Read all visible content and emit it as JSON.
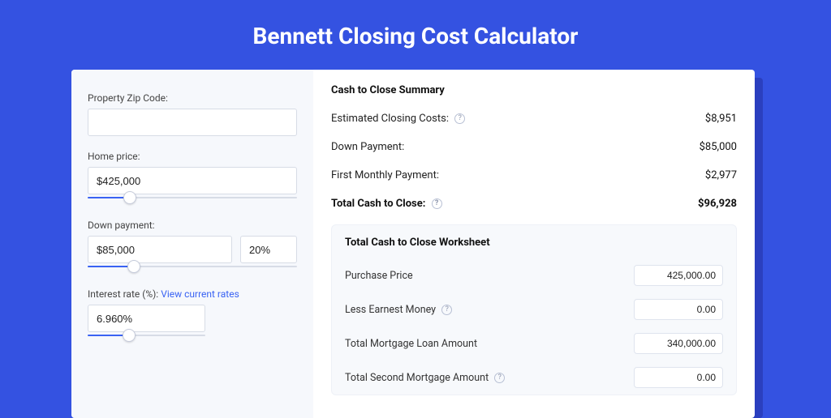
{
  "title": "Bennett Closing Cost Calculator",
  "left": {
    "zip_label": "Property Zip Code:",
    "zip_value": "",
    "home_price_label": "Home price:",
    "home_price_value": "$425,000",
    "home_price_slider_pct": 20,
    "down_payment_label": "Down payment:",
    "down_payment_value": "$85,000",
    "down_payment_pct": "20%",
    "down_payment_slider_pct": 22,
    "interest_label": "Interest rate (%):",
    "interest_link": "View current rates",
    "interest_value": "6.960%",
    "interest_slider_pct": 35
  },
  "summary": {
    "heading": "Cash to Close Summary",
    "rows": [
      {
        "label": "Estimated Closing Costs:",
        "help": true,
        "value": "$8,951"
      },
      {
        "label": "Down Payment:",
        "help": false,
        "value": "$85,000"
      },
      {
        "label": "First Monthly Payment:",
        "help": false,
        "value": "$2,977"
      }
    ],
    "total_label": "Total Cash to Close:",
    "total_help": true,
    "total_value": "$96,928"
  },
  "worksheet": {
    "heading": "Total Cash to Close Worksheet",
    "rows": [
      {
        "label": "Purchase Price",
        "help": false,
        "value": "425,000.00"
      },
      {
        "label": "Less Earnest Money",
        "help": true,
        "value": "0.00"
      },
      {
        "label": "Total Mortgage Loan Amount",
        "help": false,
        "value": "340,000.00"
      },
      {
        "label": "Total Second Mortgage Amount",
        "help": true,
        "value": "0.00"
      }
    ]
  }
}
